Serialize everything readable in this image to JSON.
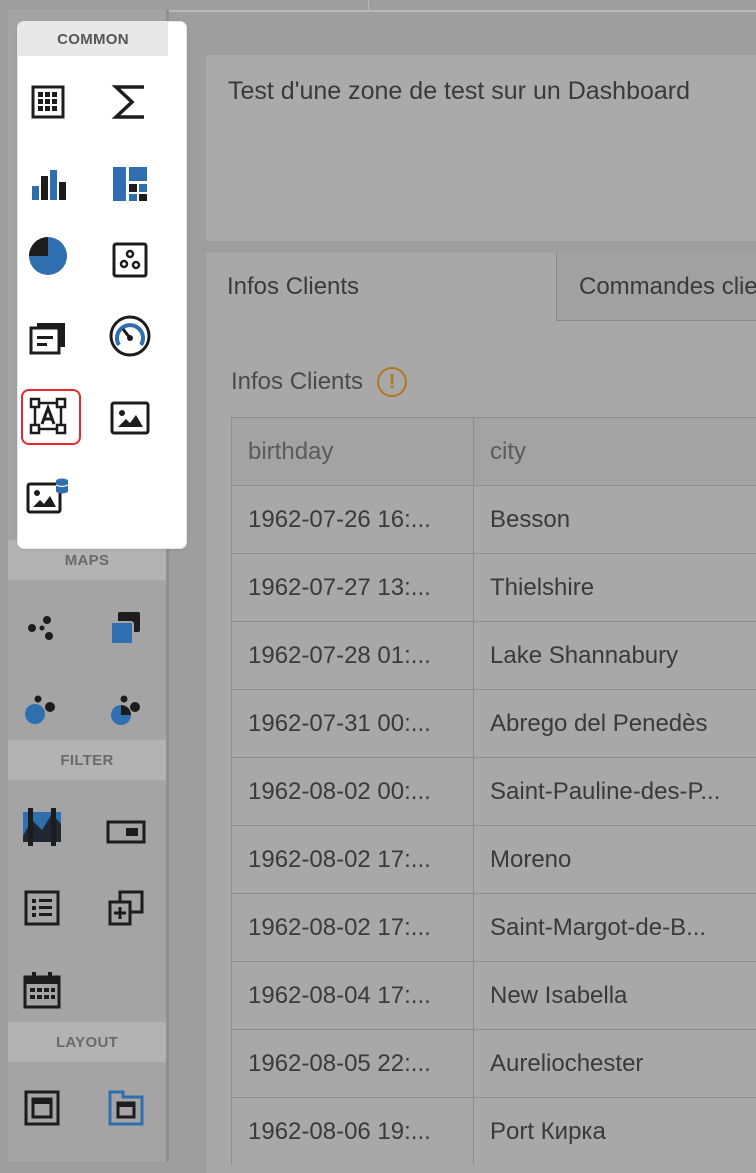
{
  "toolbox": {
    "sections": {
      "common": "COMMON",
      "maps": "MAPS",
      "filter": "FILTER",
      "layout": "LAYOUT"
    },
    "common_items": [
      "grid-icon",
      "card-sum-icon",
      "bar-chart-icon",
      "treemap-icon",
      "pie-chart-icon",
      "scatter-icon",
      "cards-icon",
      "gauge-icon",
      "text-box-icon",
      "image-icon",
      "bound-image-icon"
    ],
    "selected_item": "text-box-icon",
    "accent_color": "#2f6fb0",
    "selection_color": "#e8282d"
  },
  "textbox": {
    "text": "Test d'une zone de test sur un Dashboard"
  },
  "tabs": [
    {
      "label": "Infos Clients",
      "active": true
    },
    {
      "label": "Commandes clients",
      "active": false
    }
  ],
  "grid": {
    "title": "Infos Clients",
    "warning_icon": "!",
    "columns": [
      "birthday",
      "city"
    ],
    "rows": [
      [
        "1962-07-26 16:...",
        "Besson"
      ],
      [
        "1962-07-27 13:...",
        "Thielshire"
      ],
      [
        "1962-07-28 01:...",
        "Lake Shannabury"
      ],
      [
        "1962-07-31 00:...",
        "Abrego del Penedès"
      ],
      [
        "1962-08-02 00:...",
        "Saint-Pauline-des-P..."
      ],
      [
        "1962-08-02 17:...",
        "Moreno"
      ],
      [
        "1962-08-02 17:...",
        "Saint-Margot-de-B..."
      ],
      [
        "1962-08-04 17:...",
        "New Isabella"
      ],
      [
        "1962-08-05 22:...",
        "Aureliochester"
      ],
      [
        "1962-08-06 19:...",
        "Port Кирка"
      ]
    ]
  }
}
